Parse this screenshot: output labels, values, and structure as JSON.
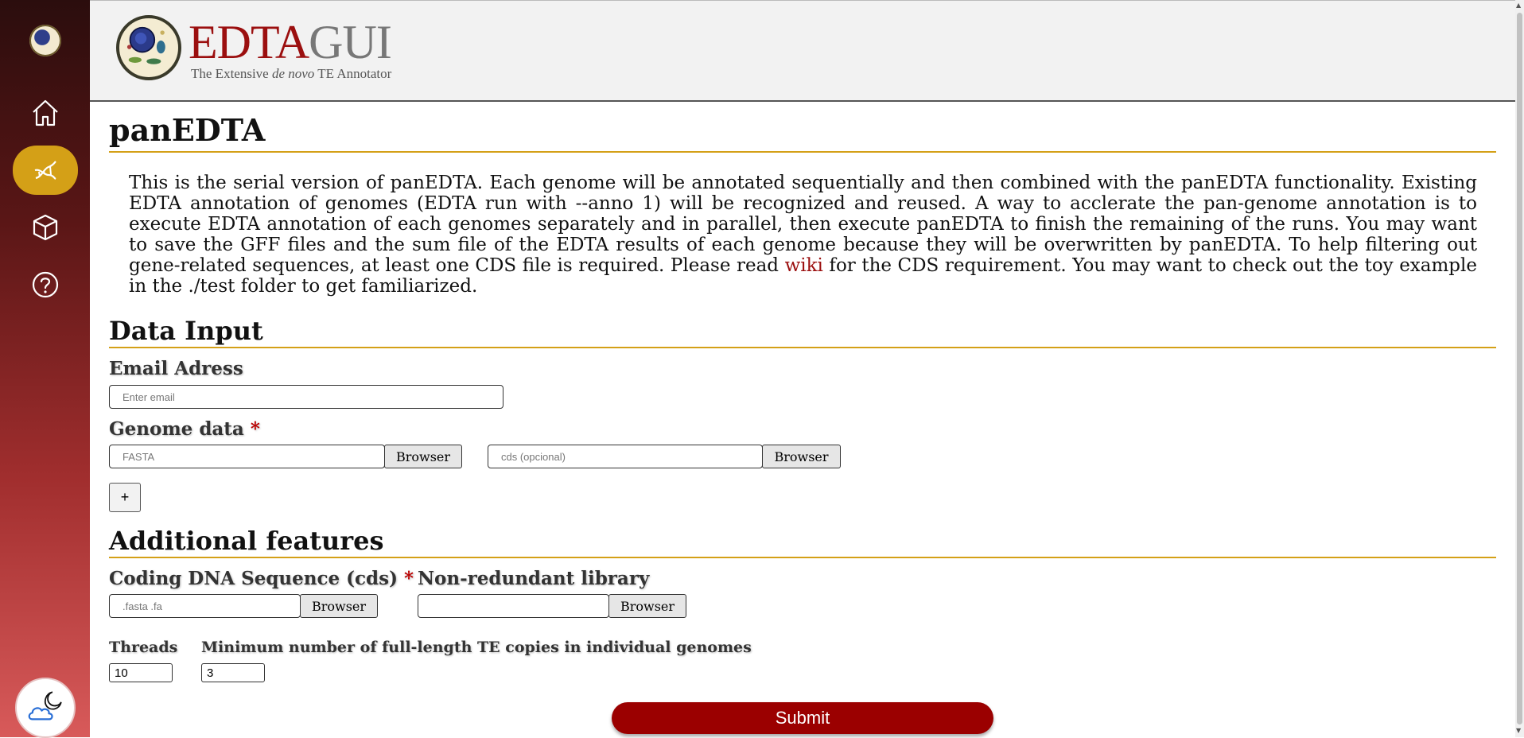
{
  "header": {
    "brand_edta": "EDTA",
    "brand_gui": "GUI",
    "subtitle_prefix": "The Extensive ",
    "subtitle_em": "de novo",
    "subtitle_suffix": " TE Annotator"
  },
  "sidebar": {
    "items": [
      {
        "icon": "home-icon",
        "active": false
      },
      {
        "icon": "dna-icon",
        "active": true
      },
      {
        "icon": "box-icon",
        "active": false
      },
      {
        "icon": "help-icon",
        "active": false
      }
    ],
    "theme_icon": "moon-cloud-icon",
    "active_color": "#d4a017"
  },
  "page": {
    "title": "panEDTA",
    "intro_before_link": "This is the serial version of panEDTA. Each genome will be annotated sequentially and then combined with the panEDTA functionality. Existing EDTA annotation of genomes (EDTA run with --anno 1) will be recognized and reused. A way to acclerate the pan-genome annotation is to execute EDTA annotation of each genomes separately and in parallel, then execute panEDTA to finish the remaining of the runs. You may want to save the GFF files and the sum file of the EDTA results of each genome because they will be overwritten by panEDTA. To help filtering out gene-related sequences, at least one CDS file is required. Please read ",
    "intro_link": "wiki",
    "intro_after_link": " for the CDS requirement. You may want to check out the toy example in the ./test folder to get familiarized."
  },
  "data_input": {
    "heading": "Data Input",
    "email_label": "Email Adress",
    "email_placeholder": "Enter email",
    "email_value": "",
    "genome_label": "Genome data",
    "required_mark": "*",
    "fasta_placeholder": "FASTA",
    "cds_placeholder": "cds (opcional)",
    "browse_label": "Browser",
    "add_label": "+"
  },
  "additional": {
    "heading": "Additional features",
    "cds_label": "Coding DNA Sequence (cds)",
    "cds_placeholder": ".fasta .fa",
    "nonredundant_label": "Non-redundant library",
    "nonredundant_placeholder": "",
    "browse_label": "Browser",
    "threads_label": "Threads",
    "threads_value": "10",
    "min_copies_label": "Minimum number of full-length TE copies in individual genomes",
    "min_copies_value": "3"
  },
  "submit_label": "Submit",
  "colors": {
    "accent": "#9b0f0f",
    "rule": "#d4a017",
    "submit": "#9b0000"
  }
}
